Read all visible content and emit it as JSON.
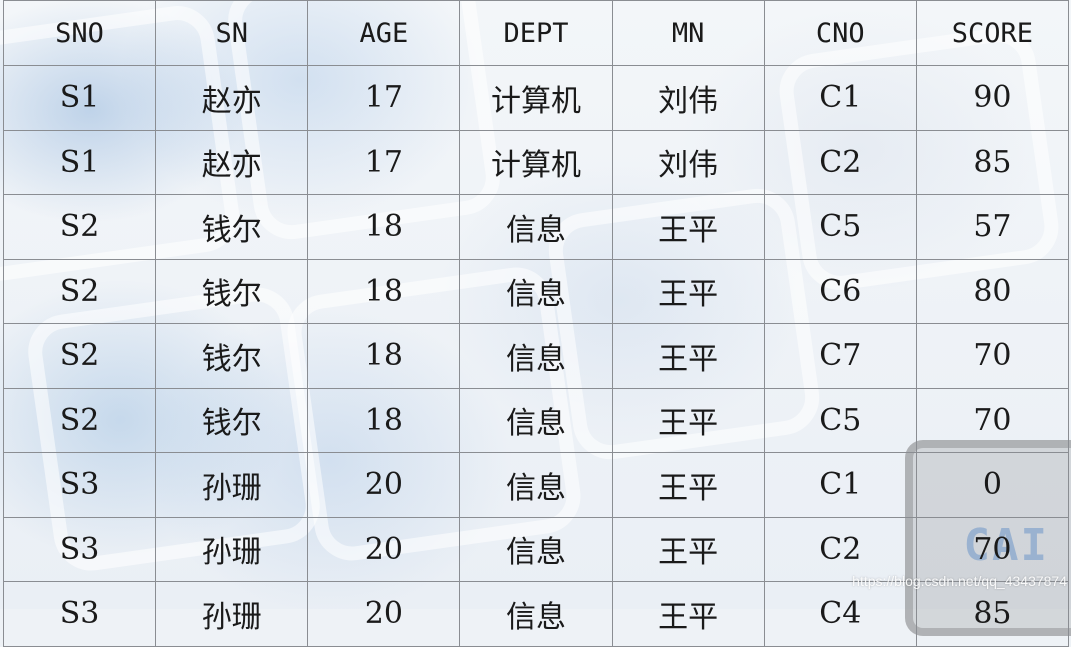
{
  "table": {
    "headers": [
      "SNO",
      "SN",
      "AGE",
      "DEPT",
      "MN",
      "CNO",
      "SCORE"
    ],
    "rows": [
      [
        "S1",
        "赵亦",
        "17",
        "计算机",
        "刘伟",
        "C1",
        "90"
      ],
      [
        "S1",
        "赵亦",
        "17",
        "计算机",
        "刘伟",
        "C2",
        "85"
      ],
      [
        "S2",
        "钱尔",
        "18",
        "信息",
        "王平",
        "C5",
        "57"
      ],
      [
        "S2",
        "钱尔",
        "18",
        "信息",
        "王平",
        "C6",
        "80"
      ],
      [
        "S2",
        "钱尔",
        "18",
        "信息",
        "王平",
        "C7",
        "70"
      ],
      [
        "S2",
        "钱尔",
        "18",
        "信息",
        "王平",
        "C5",
        "70"
      ],
      [
        "S3",
        "孙珊",
        "20",
        "信息",
        "王平",
        "C1",
        "0"
      ],
      [
        "S3",
        "孙珊",
        "20",
        "信息",
        "王平",
        "C2",
        "70"
      ],
      [
        "S3",
        "孙珊",
        "20",
        "信息",
        "王平",
        "C4",
        "85"
      ]
    ]
  },
  "watermark": {
    "url": "https://blog.csdn.net/qq_43437874",
    "logo_text": "CAI"
  },
  "colors": {
    "border": "#8a8d92",
    "text": "#1a1a1a"
  }
}
